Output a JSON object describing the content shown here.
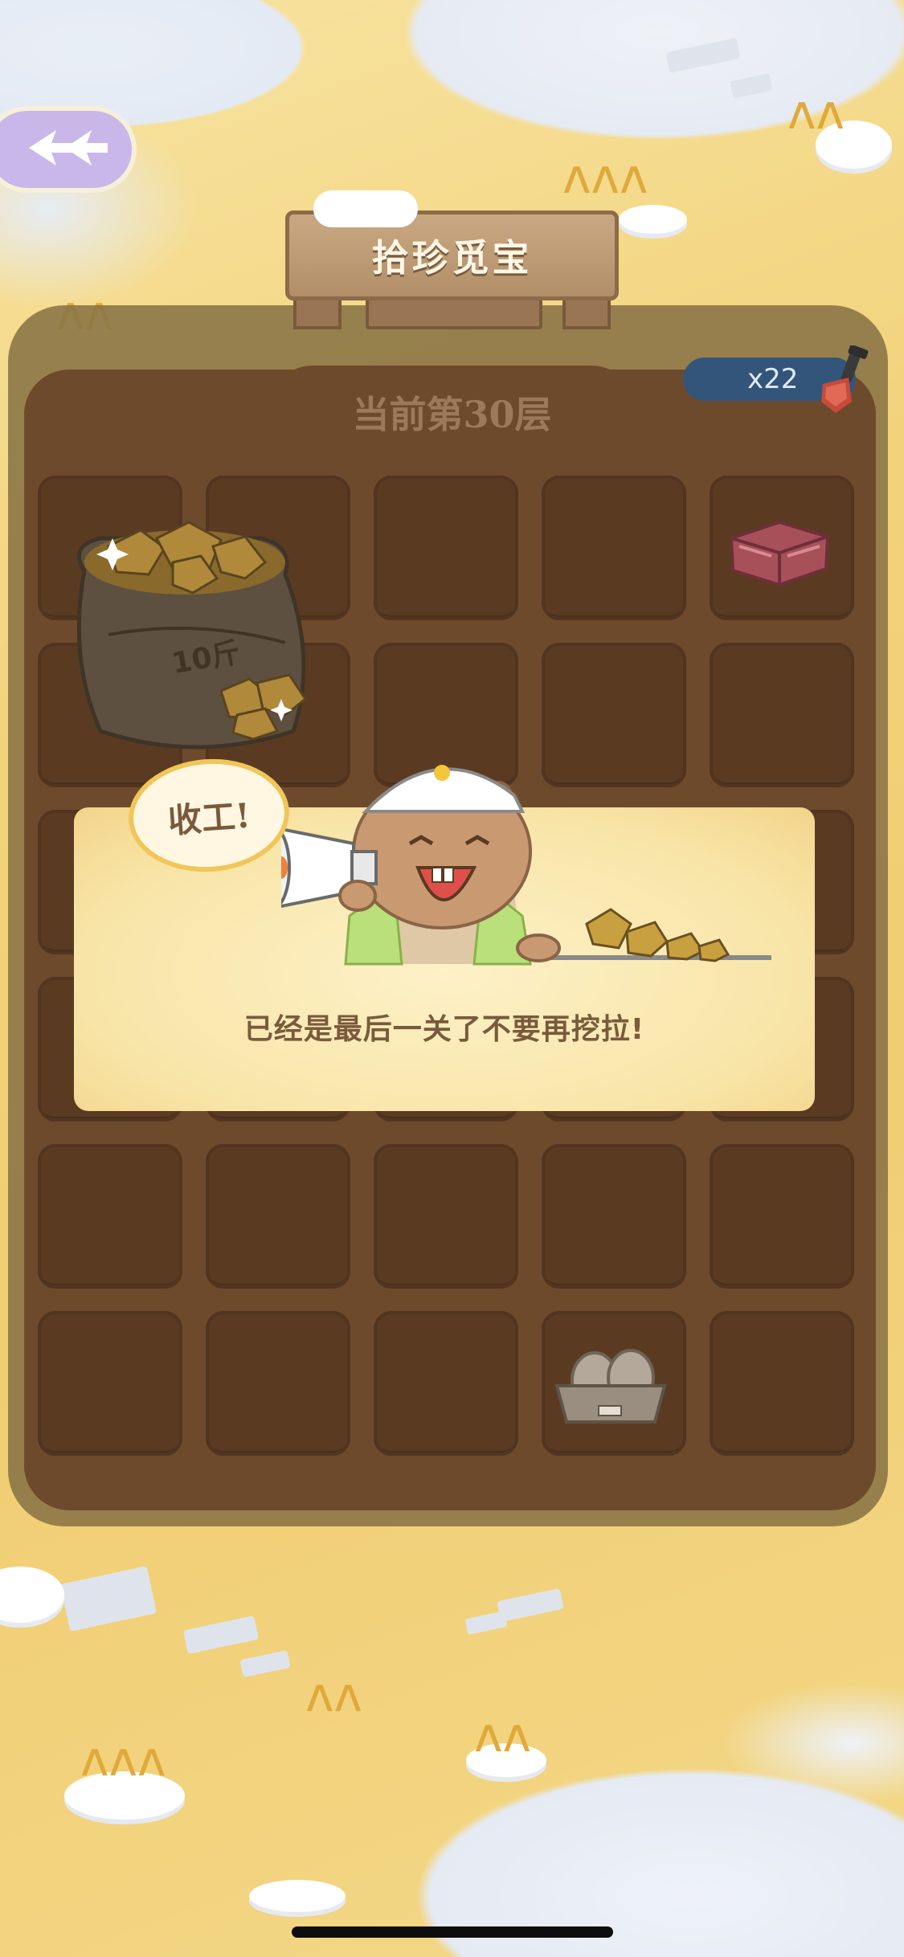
{
  "header": {
    "back_icon": "winged-arrow-back-icon",
    "title": "拾珍觅宝"
  },
  "board": {
    "level_label": "当前第30层",
    "shovel_count": "x22",
    "shovel_icon": "shovel-icon",
    "items": {
      "gold_sack": "gold-ore-sack-icon",
      "meat": "meat-slab-icon",
      "egg_tray": "egg-tray-icon"
    }
  },
  "popup": {
    "speech_bubble": "收工!",
    "message": "已经是最后一关了不要再挖拉!",
    "mascot_icon": "marmot-megaphone-icon"
  },
  "colors": {
    "board_brown": "#6e4a2c",
    "cell_brown": "#5a3b22",
    "popup_cream": "#f8e4a6",
    "counter_blue": "#34557a",
    "back_purple": "#c9b7ea"
  }
}
